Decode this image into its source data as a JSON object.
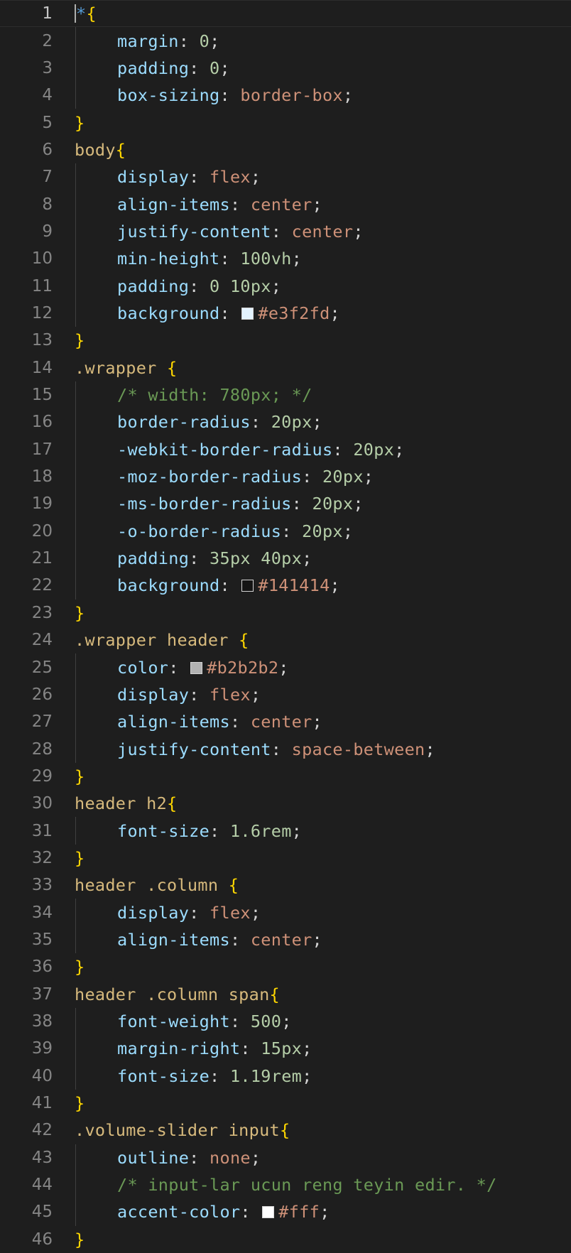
{
  "editor": {
    "current_line": 1,
    "lines": [
      {
        "n": "1",
        "indent": false,
        "tokens": [
          {
            "t": "*",
            "c": "univ"
          },
          {
            "t": "{",
            "c": "br"
          }
        ]
      },
      {
        "n": "2",
        "indent": true,
        "tokens": [
          {
            "t": "margin",
            "c": "prop"
          },
          {
            "t": ": ",
            "c": "punc"
          },
          {
            "t": "0",
            "c": "num"
          },
          {
            "t": ";",
            "c": "punc"
          }
        ]
      },
      {
        "n": "3",
        "indent": true,
        "tokens": [
          {
            "t": "padding",
            "c": "prop"
          },
          {
            "t": ": ",
            "c": "punc"
          },
          {
            "t": "0",
            "c": "num"
          },
          {
            "t": ";",
            "c": "punc"
          }
        ]
      },
      {
        "n": "4",
        "indent": true,
        "tokens": [
          {
            "t": "box-sizing",
            "c": "prop"
          },
          {
            "t": ": ",
            "c": "punc"
          },
          {
            "t": "border-box",
            "c": "val"
          },
          {
            "t": ";",
            "c": "punc"
          }
        ]
      },
      {
        "n": "5",
        "indent": false,
        "tokens": [
          {
            "t": "}",
            "c": "br"
          }
        ]
      },
      {
        "n": "6",
        "indent": false,
        "tokens": [
          {
            "t": "body",
            "c": "sel"
          },
          {
            "t": "{",
            "c": "br"
          }
        ]
      },
      {
        "n": "7",
        "indent": true,
        "tokens": [
          {
            "t": "display",
            "c": "prop"
          },
          {
            "t": ": ",
            "c": "punc"
          },
          {
            "t": "flex",
            "c": "val"
          },
          {
            "t": ";",
            "c": "punc"
          }
        ]
      },
      {
        "n": "8",
        "indent": true,
        "tokens": [
          {
            "t": "align-items",
            "c": "prop"
          },
          {
            "t": ": ",
            "c": "punc"
          },
          {
            "t": "center",
            "c": "val"
          },
          {
            "t": ";",
            "c": "punc"
          }
        ]
      },
      {
        "n": "9",
        "indent": true,
        "tokens": [
          {
            "t": "justify-content",
            "c": "prop"
          },
          {
            "t": ": ",
            "c": "punc"
          },
          {
            "t": "center",
            "c": "val"
          },
          {
            "t": ";",
            "c": "punc"
          }
        ]
      },
      {
        "n": "10",
        "indent": true,
        "tokens": [
          {
            "t": "min-height",
            "c": "prop"
          },
          {
            "t": ": ",
            "c": "punc"
          },
          {
            "t": "100vh",
            "c": "num"
          },
          {
            "t": ";",
            "c": "punc"
          }
        ]
      },
      {
        "n": "11",
        "indent": true,
        "tokens": [
          {
            "t": "padding",
            "c": "prop"
          },
          {
            "t": ": ",
            "c": "punc"
          },
          {
            "t": "0 10px",
            "c": "num"
          },
          {
            "t": ";",
            "c": "punc"
          }
        ]
      },
      {
        "n": "12",
        "indent": true,
        "tokens": [
          {
            "t": "background",
            "c": "prop"
          },
          {
            "t": ": ",
            "c": "punc"
          },
          {
            "swatch": "#e3f2fd"
          },
          {
            "t": "#e3f2fd",
            "c": "val"
          },
          {
            "t": ";",
            "c": "punc"
          }
        ]
      },
      {
        "n": "13",
        "indent": false,
        "tokens": [
          {
            "t": "}",
            "c": "br"
          }
        ]
      },
      {
        "n": "14",
        "indent": false,
        "tokens": [
          {
            "t": ".wrapper ",
            "c": "sel"
          },
          {
            "t": "{",
            "c": "br"
          }
        ]
      },
      {
        "n": "15",
        "indent": true,
        "tokens": [
          {
            "t": "/* width: 780px; */",
            "c": "cmt"
          }
        ]
      },
      {
        "n": "16",
        "indent": true,
        "tokens": [
          {
            "t": "border-radius",
            "c": "prop"
          },
          {
            "t": ": ",
            "c": "punc"
          },
          {
            "t": "20px",
            "c": "num"
          },
          {
            "t": ";",
            "c": "punc"
          }
        ]
      },
      {
        "n": "17",
        "indent": true,
        "tokens": [
          {
            "t": "-webkit-border-radius",
            "c": "prop"
          },
          {
            "t": ": ",
            "c": "punc"
          },
          {
            "t": "20px",
            "c": "num"
          },
          {
            "t": ";",
            "c": "punc"
          }
        ]
      },
      {
        "n": "18",
        "indent": true,
        "tokens": [
          {
            "t": "-moz-border-radius",
            "c": "prop"
          },
          {
            "t": ": ",
            "c": "punc"
          },
          {
            "t": "20px",
            "c": "num"
          },
          {
            "t": ";",
            "c": "punc"
          }
        ]
      },
      {
        "n": "19",
        "indent": true,
        "tokens": [
          {
            "t": "-ms-border-radius",
            "c": "prop"
          },
          {
            "t": ": ",
            "c": "punc"
          },
          {
            "t": "20px",
            "c": "num"
          },
          {
            "t": ";",
            "c": "punc"
          }
        ]
      },
      {
        "n": "20",
        "indent": true,
        "tokens": [
          {
            "t": "-o-border-radius",
            "c": "prop"
          },
          {
            "t": ": ",
            "c": "punc"
          },
          {
            "t": "20px",
            "c": "num"
          },
          {
            "t": ";",
            "c": "punc"
          }
        ]
      },
      {
        "n": "21",
        "indent": true,
        "tokens": [
          {
            "t": "padding",
            "c": "prop"
          },
          {
            "t": ": ",
            "c": "punc"
          },
          {
            "t": "35px 40px",
            "c": "num"
          },
          {
            "t": ";",
            "c": "punc"
          }
        ]
      },
      {
        "n": "22",
        "indent": true,
        "tokens": [
          {
            "t": "background",
            "c": "prop"
          },
          {
            "t": ": ",
            "c": "punc"
          },
          {
            "swatch": "#141414"
          },
          {
            "t": "#141414",
            "c": "val"
          },
          {
            "t": ";",
            "c": "punc"
          }
        ]
      },
      {
        "n": "23",
        "indent": false,
        "tokens": [
          {
            "t": "}",
            "c": "br"
          }
        ]
      },
      {
        "n": "24",
        "indent": false,
        "tokens": [
          {
            "t": ".wrapper header ",
            "c": "sel"
          },
          {
            "t": "{",
            "c": "br"
          }
        ]
      },
      {
        "n": "25",
        "indent": true,
        "tokens": [
          {
            "t": "color",
            "c": "prop"
          },
          {
            "t": ": ",
            "c": "punc"
          },
          {
            "swatch": "#b2b2b2"
          },
          {
            "t": "#b2b2b2",
            "c": "val"
          },
          {
            "t": ";",
            "c": "punc"
          }
        ]
      },
      {
        "n": "26",
        "indent": true,
        "tokens": [
          {
            "t": "display",
            "c": "prop"
          },
          {
            "t": ": ",
            "c": "punc"
          },
          {
            "t": "flex",
            "c": "val"
          },
          {
            "t": ";",
            "c": "punc"
          }
        ]
      },
      {
        "n": "27",
        "indent": true,
        "tokens": [
          {
            "t": "align-items",
            "c": "prop"
          },
          {
            "t": ": ",
            "c": "punc"
          },
          {
            "t": "center",
            "c": "val"
          },
          {
            "t": ";",
            "c": "punc"
          }
        ]
      },
      {
        "n": "28",
        "indent": true,
        "tokens": [
          {
            "t": "justify-content",
            "c": "prop"
          },
          {
            "t": ": ",
            "c": "punc"
          },
          {
            "t": "space-between",
            "c": "val"
          },
          {
            "t": ";",
            "c": "punc"
          }
        ]
      },
      {
        "n": "29",
        "indent": false,
        "tokens": [
          {
            "t": "}",
            "c": "br"
          }
        ]
      },
      {
        "n": "30",
        "indent": false,
        "tokens": [
          {
            "t": "header h2",
            "c": "sel"
          },
          {
            "t": "{",
            "c": "br"
          }
        ]
      },
      {
        "n": "31",
        "indent": true,
        "tokens": [
          {
            "t": "font-size",
            "c": "prop"
          },
          {
            "t": ": ",
            "c": "punc"
          },
          {
            "t": "1.6rem",
            "c": "num"
          },
          {
            "t": ";",
            "c": "punc"
          }
        ]
      },
      {
        "n": "32",
        "indent": false,
        "tokens": [
          {
            "t": "}",
            "c": "br"
          }
        ]
      },
      {
        "n": "33",
        "indent": false,
        "tokens": [
          {
            "t": "header .column ",
            "c": "sel"
          },
          {
            "t": "{",
            "c": "br"
          }
        ]
      },
      {
        "n": "34",
        "indent": true,
        "tokens": [
          {
            "t": "display",
            "c": "prop"
          },
          {
            "t": ": ",
            "c": "punc"
          },
          {
            "t": "flex",
            "c": "val"
          },
          {
            "t": ";",
            "c": "punc"
          }
        ]
      },
      {
        "n": "35",
        "indent": true,
        "tokens": [
          {
            "t": "align-items",
            "c": "prop"
          },
          {
            "t": ": ",
            "c": "punc"
          },
          {
            "t": "center",
            "c": "val"
          },
          {
            "t": ";",
            "c": "punc"
          }
        ]
      },
      {
        "n": "36",
        "indent": false,
        "tokens": [
          {
            "t": "}",
            "c": "br"
          }
        ]
      },
      {
        "n": "37",
        "indent": false,
        "tokens": [
          {
            "t": "header .column span",
            "c": "sel"
          },
          {
            "t": "{",
            "c": "br"
          }
        ]
      },
      {
        "n": "38",
        "indent": true,
        "tokens": [
          {
            "t": "font-weight",
            "c": "prop"
          },
          {
            "t": ": ",
            "c": "punc"
          },
          {
            "t": "500",
            "c": "num"
          },
          {
            "t": ";",
            "c": "punc"
          }
        ]
      },
      {
        "n": "39",
        "indent": true,
        "tokens": [
          {
            "t": "margin-right",
            "c": "prop"
          },
          {
            "t": ": ",
            "c": "punc"
          },
          {
            "t": "15px",
            "c": "num"
          },
          {
            "t": ";",
            "c": "punc"
          }
        ]
      },
      {
        "n": "40",
        "indent": true,
        "tokens": [
          {
            "t": "font-size",
            "c": "prop"
          },
          {
            "t": ": ",
            "c": "punc"
          },
          {
            "t": "1.19rem",
            "c": "num"
          },
          {
            "t": ";",
            "c": "punc"
          }
        ]
      },
      {
        "n": "41",
        "indent": false,
        "tokens": [
          {
            "t": "}",
            "c": "br"
          }
        ]
      },
      {
        "n": "42",
        "indent": false,
        "tokens": [
          {
            "t": ".volume-slider input",
            "c": "sel"
          },
          {
            "t": "{",
            "c": "br"
          }
        ]
      },
      {
        "n": "43",
        "indent": true,
        "tokens": [
          {
            "t": "outline",
            "c": "prop"
          },
          {
            "t": ": ",
            "c": "punc"
          },
          {
            "t": "none",
            "c": "val"
          },
          {
            "t": ";",
            "c": "punc"
          }
        ]
      },
      {
        "n": "44",
        "indent": true,
        "tokens": [
          {
            "t": "/* input-lar ucun reng teyin edir. */",
            "c": "cmt"
          }
        ]
      },
      {
        "n": "45",
        "indent": true,
        "tokens": [
          {
            "t": "accent-color",
            "c": "prop"
          },
          {
            "t": ": ",
            "c": "punc"
          },
          {
            "swatch": "#fff"
          },
          {
            "t": "#fff",
            "c": "val"
          },
          {
            "t": ";",
            "c": "punc"
          }
        ]
      },
      {
        "n": "46",
        "indent": false,
        "tokens": [
          {
            "t": "}",
            "c": "br"
          }
        ]
      }
    ]
  }
}
